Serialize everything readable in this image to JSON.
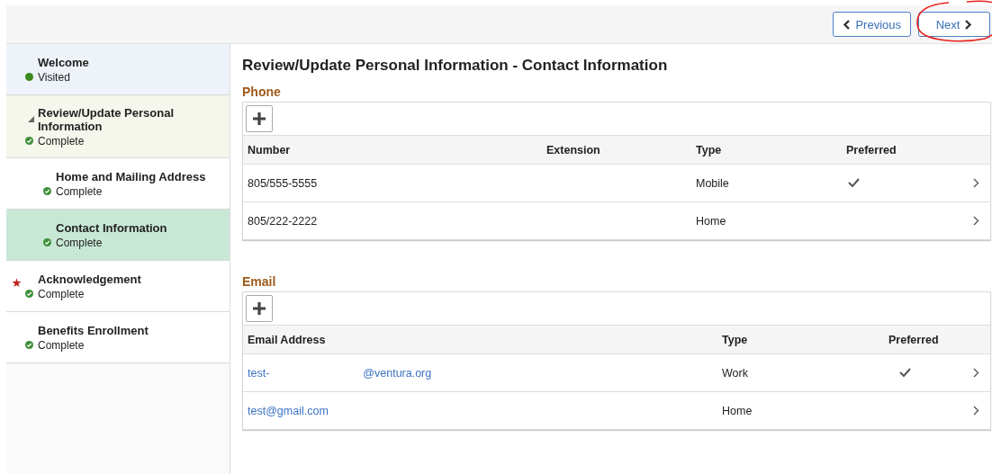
{
  "toolbar": {
    "buttons": [
      {
        "label": "Previous",
        "kind": "previous",
        "highlighted": false
      },
      {
        "label": "Next",
        "kind": "next",
        "highlighted": true
      }
    ]
  },
  "sidebar": {
    "items": [
      {
        "title": "Welcome",
        "status": "Visited",
        "kind": "visited",
        "selected": false,
        "required": false
      },
      {
        "title": "Review/Update Personal Information",
        "status": "Complete",
        "kind": "complete",
        "selected": false,
        "required": false,
        "expanded": true,
        "children": [
          {
            "title": "Home and Mailing Address",
            "status": "Complete",
            "kind": "complete",
            "selected": false,
            "required": false
          },
          {
            "title": "Contact Information",
            "status": "Complete",
            "kind": "complete",
            "selected": true,
            "required": false
          }
        ]
      },
      {
        "title": "Acknowledgement",
        "status": "Complete",
        "kind": "complete",
        "selected": false,
        "required": true
      },
      {
        "title": "Benefits Enrollment",
        "status": "Complete",
        "kind": "complete",
        "selected": false,
        "required": false
      }
    ]
  },
  "page_title": "Review/Update Personal Information - Contact Information",
  "sections": [
    {
      "heading": "Phone",
      "columns": [
        {
          "label": "Number",
          "kind": "text"
        },
        {
          "label": "Extension",
          "kind": "text"
        },
        {
          "label": "Type",
          "kind": "text"
        },
        {
          "label": "Preferred",
          "kind": "check"
        }
      ],
      "rows": [
        {
          "cells": [
            "805/555-5555",
            "",
            "Mobile"
          ],
          "preferred": true
        },
        {
          "cells": [
            "805/222-2222",
            "",
            "Home"
          ],
          "preferred": false
        }
      ]
    },
    {
      "heading": "Email",
      "columns": [
        {
          "label": "Email Address",
          "kind": "link"
        },
        {
          "label": "Type",
          "kind": "text"
        },
        {
          "label": "Preferred",
          "kind": "check"
        }
      ],
      "rows": [
        {
          "cells": [
            [
              "test-",
              "@ventura.org"
            ],
            "Work"
          ],
          "preferred": true
        },
        {
          "cells": [
            [
              "test@gmail.com"
            ],
            "Home"
          ],
          "preferred": false
        }
      ]
    }
  ]
}
